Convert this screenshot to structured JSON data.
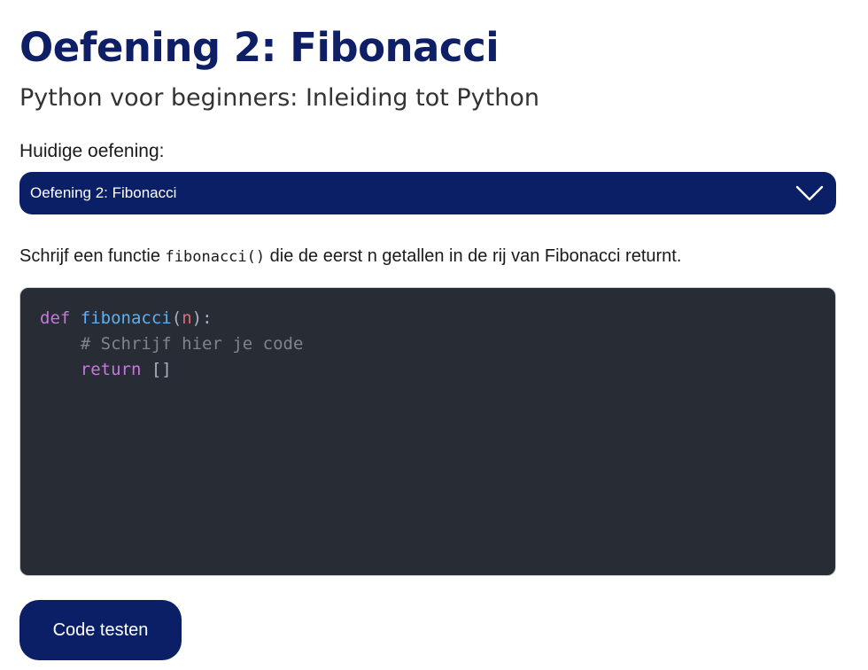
{
  "header": {
    "title": "Oefening 2: Fibonacci",
    "subtitle": "Python voor beginners: Inleiding tot Python"
  },
  "exercise_select": {
    "label": "Huidige oefening:",
    "selected": "Oefening 2: Fibonacci",
    "icon": "chevron-down-icon"
  },
  "description": {
    "before": "Schrijf een functie ",
    "code": "fibonacci()",
    "after": " die de eerst n getallen in de rij van Fibonacci returnt."
  },
  "editor": {
    "line1": {
      "kw": "def",
      "fn": "fibonacci",
      "open": "(",
      "param": "n",
      "close": "):"
    },
    "line2": {
      "indent": "    ",
      "comment": "# Schrijf hier je code"
    },
    "line3": {
      "indent": "    ",
      "kw": "return",
      "rest": " []"
    }
  },
  "actions": {
    "test_label": "Code testen"
  },
  "colors": {
    "brand": "#0b1f66",
    "editor_bg": "#282c34",
    "keyword": "#c678dd",
    "function": "#61afef",
    "parameter": "#e06c75",
    "comment": "#7f848e"
  }
}
